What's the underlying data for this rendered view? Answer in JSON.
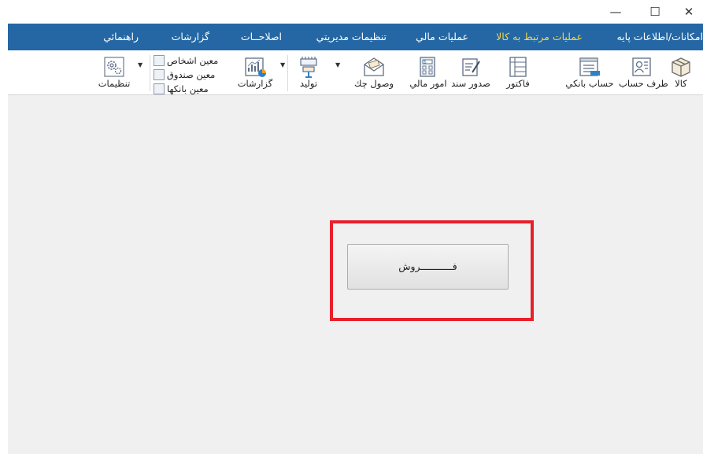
{
  "window": {
    "minimize": "—",
    "maximize": "☐",
    "close": "✕"
  },
  "menu": {
    "items": [
      {
        "label": "امکانات/اطلاعات پايه"
      },
      {
        "label": "عمليات مرتبط به كالا",
        "active": true
      },
      {
        "label": "عمليات مالي"
      },
      {
        "label": "تنظيمات مديريتي"
      },
      {
        "label": "اصلاحــات"
      },
      {
        "label": "گزارشات"
      },
      {
        "label": "راهنمائي"
      }
    ]
  },
  "ribbon": {
    "kala": "كالا",
    "taraf_hesab": "طرف حساب",
    "hesab_banki": "حساب بانكي",
    "factor": "فاكتور",
    "sodoor_sanad": "صدور سند",
    "omoor_mali": "امور مالي",
    "vosool_check": "وصول چك",
    "tolid": "توليد",
    "gozareshat": "گزارشات",
    "moein_ashkhas": "معين اشخاص",
    "moein_sandoogh": "معين صندوق",
    "moein_bankha": "معين بانكها",
    "tanzimat": "تنظيمات"
  },
  "main": {
    "sell_button": "فـــــــــــروش"
  },
  "colors": {
    "menubar": "#2467a4",
    "active_menu": "#f6d645",
    "highlight": "#e8202a",
    "content_bg": "#f0f0f0"
  }
}
